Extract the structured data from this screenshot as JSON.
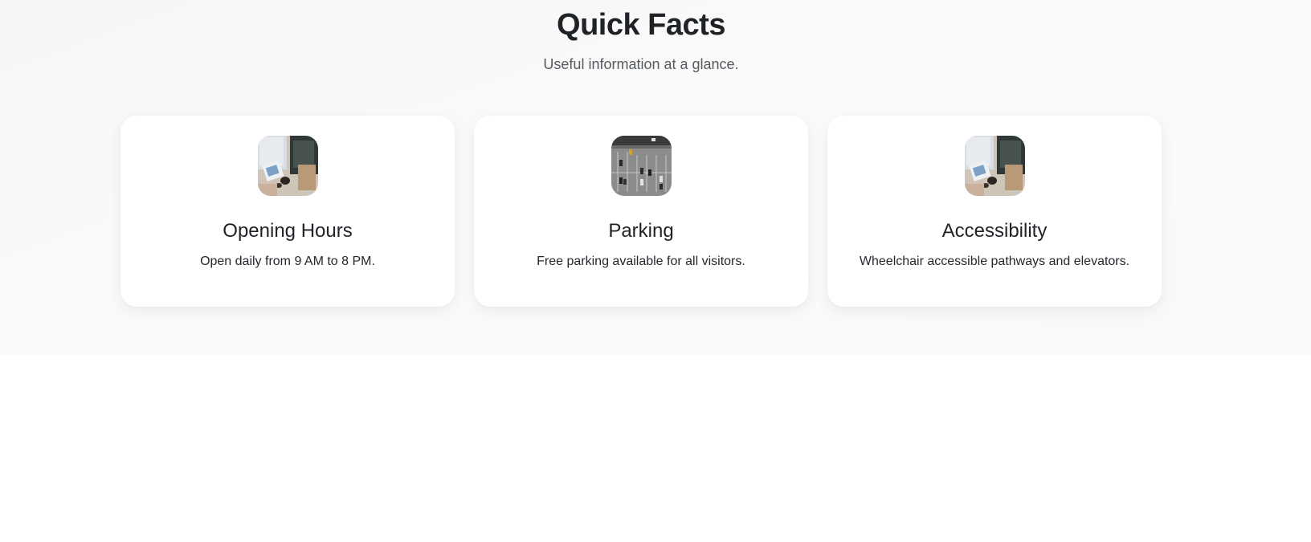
{
  "section": {
    "title": "Quick Facts",
    "subtitle": "Useful information at a glance."
  },
  "cards": [
    {
      "title": "Opening Hours",
      "description": "Open daily from 9 AM to 8 PM.",
      "image": "flatlay-desk-photo"
    },
    {
      "title": "Parking",
      "description": "Free parking available for all visitors.",
      "image": "aerial-parking-lot-photo"
    },
    {
      "title": "Accessibility",
      "description": "Wheelchair accessible pathways and elevators.",
      "image": "flatlay-desk-photo"
    }
  ]
}
